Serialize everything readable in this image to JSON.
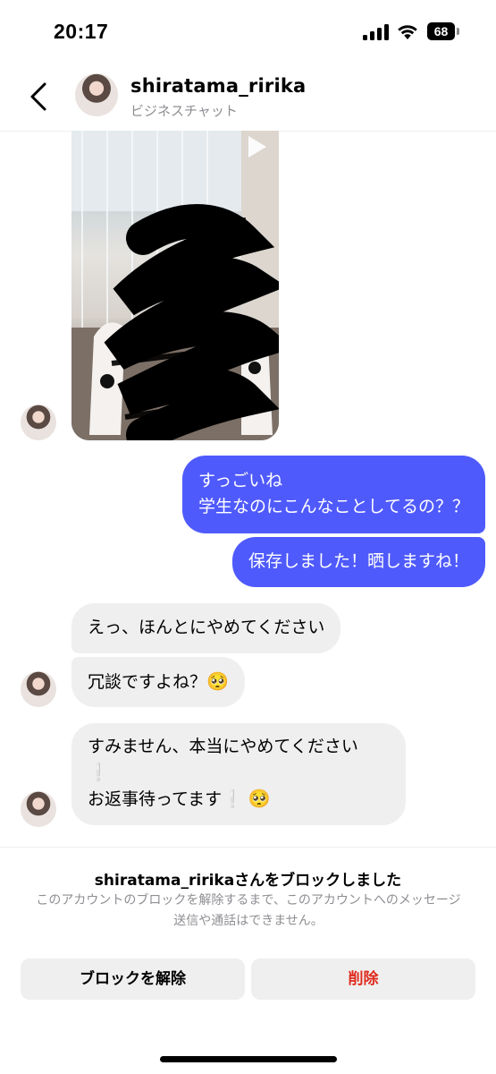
{
  "status_bar": {
    "time": "20:17",
    "battery": "68"
  },
  "header": {
    "username": "shiratama_ririka",
    "subtitle": "ビジネスチャット"
  },
  "messages": {
    "outgoing": [
      {
        "lines": [
          "すっごいね",
          "学生なのにこんなことしてるの？？"
        ]
      },
      {
        "lines": [
          "保存しました！晒しますね！"
        ]
      }
    ],
    "incoming": [
      {
        "text": "えっ、ほんとにやめてください"
      },
      {
        "text": "冗談ですよね？",
        "emoji": "🥺"
      },
      {
        "line1": "すみません、本当にやめてください",
        "excl": "❕",
        "line2": "お返事待ってます",
        "emoji": "🥺"
      }
    ]
  },
  "block_notice": {
    "title": "shiratama_ririkaさんをブロックしました",
    "description": "このアカウントのブロックを解除するまで、このアカウントへのメッセージ送信や通話はできません。"
  },
  "actions": {
    "unblock_label": "ブロックを解除",
    "delete_label": "削除"
  },
  "colors": {
    "outgoing_bubble": "#4f5afc",
    "incoming_bubble": "#efefef",
    "delete_text": "#e0291d"
  }
}
